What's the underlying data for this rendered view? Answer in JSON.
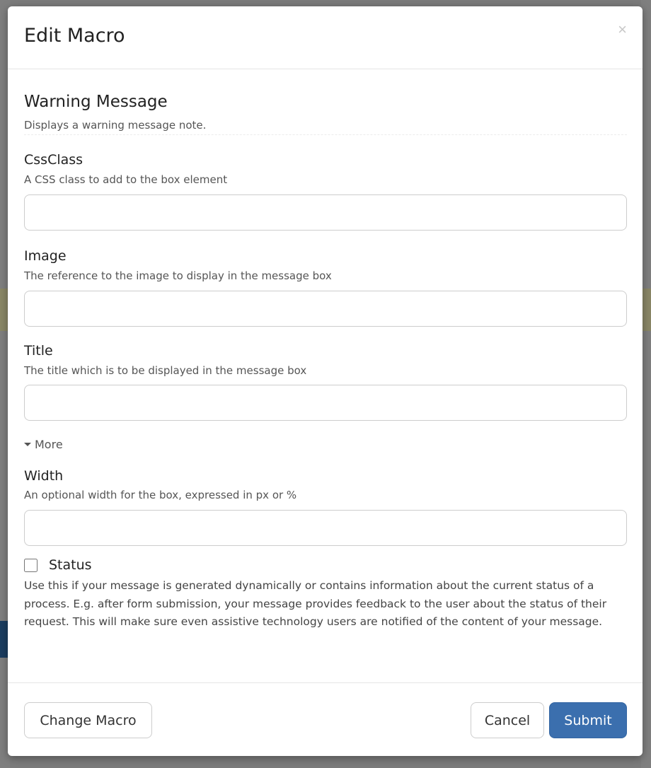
{
  "dialog": {
    "title": "Edit Macro",
    "close_label": "×"
  },
  "macro": {
    "name": "Warning Message",
    "description": "Displays a warning message note."
  },
  "fields": [
    {
      "label": "CssClass",
      "hint": "A CSS class to add to the box element",
      "value": ""
    },
    {
      "label": "Image",
      "hint": "The reference to the image to display in the message box",
      "value": ""
    },
    {
      "label": "Title",
      "hint": "The title which is to be displayed in the message box",
      "value": ""
    }
  ],
  "more_toggle": {
    "label": "More",
    "icon": "caret-down-icon"
  },
  "advanced_fields": [
    {
      "label": "Width",
      "hint": "An optional width for the box, expressed in px or %",
      "value": ""
    }
  ],
  "status": {
    "label": "Status",
    "checked": false,
    "description": "Use this if your message is generated dynamically or contains information about the current status of a process. E.g. after form submission, your message provides feedback to the user about the status of their request. This will make sure even assistive technology users are notified of the content of your message."
  },
  "footer": {
    "change_macro_label": "Change Macro",
    "cancel_label": "Cancel",
    "submit_label": "Submit"
  },
  "colors": {
    "primary": "#3b6fae",
    "overlay": "#7b7b7b"
  }
}
